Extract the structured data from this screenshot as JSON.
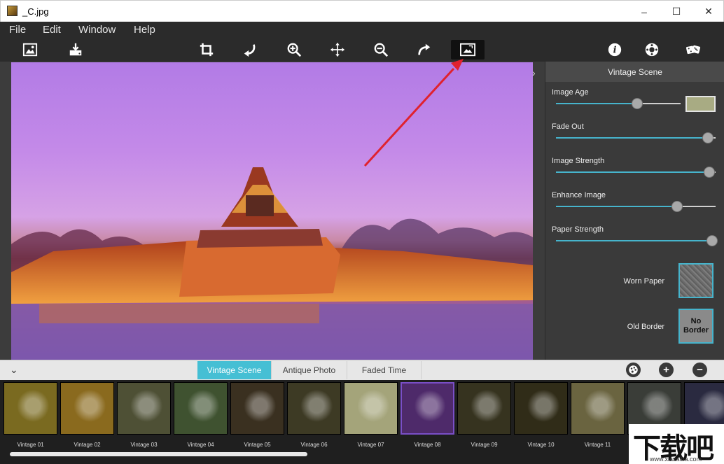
{
  "window": {
    "title": "_C.jpg",
    "minimize": "–",
    "maximize": "☐",
    "close": "✕"
  },
  "menu": [
    "File",
    "Edit",
    "Window",
    "Help"
  ],
  "toolbar": {
    "tools": [
      "open-image",
      "save",
      "crop",
      "rotate-left",
      "zoom-in",
      "move",
      "zoom-out",
      "rotate-right",
      "fit-image"
    ],
    "right_tools": [
      "info",
      "settings",
      "randomize"
    ]
  },
  "panel": {
    "title": "Vintage Scene",
    "sliders": [
      {
        "label": "Image Age",
        "value": 0.65
      },
      {
        "label": "Fade Out",
        "value": 0.95
      },
      {
        "label": "Image Strength",
        "value": 0.96
      },
      {
        "label": "Enhance Image",
        "value": 0.76
      },
      {
        "label": "Paper Strength",
        "value": 0.98
      }
    ],
    "age_color": "#a8ab83",
    "accent": "#46b4cc",
    "textures": [
      {
        "label": "Worn Paper",
        "value": ""
      },
      {
        "label": "Old Border",
        "value": "No Border"
      }
    ]
  },
  "tabs": [
    "Vintage Scene",
    "Antique Photo",
    "Faded Time"
  ],
  "active_tab": 0,
  "thumbnails": [
    {
      "label": "Vintage 01",
      "tint": "#7a6a20"
    },
    {
      "label": "Vintage 02",
      "tint": "#8a6a1e"
    },
    {
      "label": "Vintage 03",
      "tint": "#4e5035"
    },
    {
      "label": "Vintage 04",
      "tint": "#3f5230"
    },
    {
      "label": "Vintage 05",
      "tint": "#3a3020"
    },
    {
      "label": "Vintage 06",
      "tint": "#3d3a24"
    },
    {
      "label": "Vintage 07",
      "tint": "#a4a47a"
    },
    {
      "label": "Vintage 08",
      "tint": "#4e2a6a"
    },
    {
      "label": "Vintage 09",
      "tint": "#36331f"
    },
    {
      "label": "Vintage 10",
      "tint": "#302c18"
    },
    {
      "label": "Vintage 11",
      "tint": "#6a6440"
    },
    {
      "label": "",
      "tint": "#3a3d38"
    },
    {
      "label": "",
      "tint": "#2a2a40"
    }
  ],
  "watermark": {
    "text": "下载吧",
    "url": "www.xiazaiba.com"
  }
}
